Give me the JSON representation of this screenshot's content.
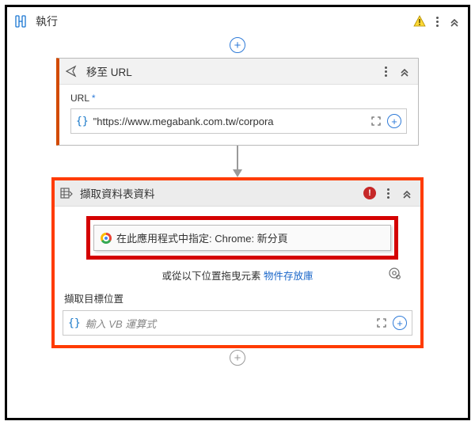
{
  "header": {
    "title": "執行"
  },
  "go_to_url": {
    "title": "移至 URL",
    "field_label": "URL",
    "required_marker": "*",
    "value": "\"https://www.megabank.com.tw/corpora"
  },
  "extract": {
    "title": "擷取資料表資料",
    "chrome_row": "在此應用程式中指定: Chrome: 新分頁",
    "drag_hint_prefix": "或從以下位置拖曳元素 ",
    "drag_hint_link": "物件存放庫",
    "target_label": "擷取目標位置",
    "target_placeholder": "輸入 VB 運算式"
  }
}
